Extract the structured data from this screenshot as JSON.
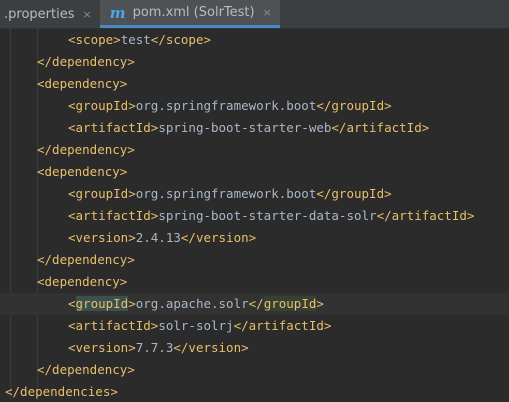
{
  "tabs": [
    {
      "label": ".properties",
      "active": false
    },
    {
      "label": "pom.xml (SolrTest)",
      "active": true
    }
  ],
  "tab_close_glyph": "×",
  "file_icon_letter": "m",
  "code": {
    "l1": {
      "open": "<scope>",
      "text": "test",
      "close": "</scope>"
    },
    "l2": {
      "tag": "</dependency>"
    },
    "l3": {
      "tag": "<dependency>"
    },
    "l4": {
      "open": "<groupId>",
      "text": "org.springframework.boot",
      "close": "</groupId>"
    },
    "l5": {
      "open": "<artifactId>",
      "text": "spring-boot-starter-web",
      "close": "</artifactId>"
    },
    "l6": {
      "tag": "</dependency>"
    },
    "l7": {
      "tag": "<dependency>"
    },
    "l8": {
      "open": "<groupId>",
      "text": "org.springframework.boot",
      "close": "</groupId>"
    },
    "l9": {
      "open": "<artifactId>",
      "text": "spring-boot-starter-data-solr",
      "close": "</artifactId>"
    },
    "l10": {
      "open": "<version>",
      "text": "2.4.13",
      "close": "</version>"
    },
    "l11": {
      "tag": "</dependency>"
    },
    "l12": {
      "tag": "<dependency>"
    },
    "l13": {
      "open_bracket": "<",
      "open_name": "groupId",
      "open_end": ">",
      "text": "org.apache.solr",
      "close_bracket": "</",
      "close_name": "groupId",
      "close_end": ">"
    },
    "l14": {
      "open": "<artifactId>",
      "text": "solr-solrj",
      "close": "</artifactId>"
    },
    "l15": {
      "open": "<version>",
      "text": "7.7.3",
      "close": "</version>"
    },
    "l16": {
      "tag": "</dependency>"
    },
    "l17": {
      "tag": "</dependencies>"
    }
  },
  "colors": {
    "background": "#2b2b2b",
    "tag": "#e8bf6a",
    "text": "#a9b7c6",
    "tab_accent": "#4a88c7",
    "match_highlight": "#3b514d"
  }
}
